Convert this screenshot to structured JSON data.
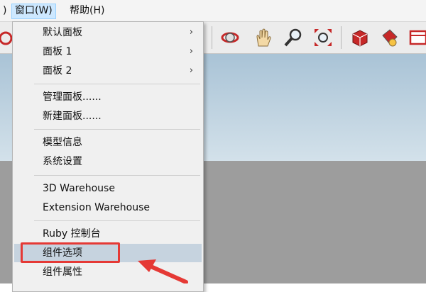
{
  "menubar": {
    "items": [
      {
        "label": ")"
      },
      {
        "label": "窗口(W)"
      },
      {
        "label": "帮助(H)"
      }
    ]
  },
  "toolbar": {
    "icons": [
      "rotate-icon",
      "orbit-icon",
      "pan-hand-icon",
      "zoom-icon",
      "zoom-extents-icon",
      "component-icon",
      "paint-bucket-icon",
      "warehouse-icon"
    ]
  },
  "window_menu": {
    "groups": [
      [
        {
          "label": "默认面板",
          "submenu": true
        },
        {
          "label": "面板 1",
          "submenu": true
        },
        {
          "label": "面板 2",
          "submenu": true
        }
      ],
      [
        {
          "label": "管理面板......"
        },
        {
          "label": "新建面板......"
        }
      ],
      [
        {
          "label": "模型信息"
        },
        {
          "label": "系统设置"
        }
      ],
      [
        {
          "label": "3D Warehouse"
        },
        {
          "label": "Extension Warehouse"
        }
      ],
      [
        {
          "label": "Ruby 控制台"
        },
        {
          "label": "组件选项",
          "highlighted": true
        },
        {
          "label": "组件属性"
        }
      ]
    ],
    "submenu_arrow": "›"
  },
  "colors": {
    "highlight": "#c6d3df",
    "annotation": "#e53935"
  }
}
